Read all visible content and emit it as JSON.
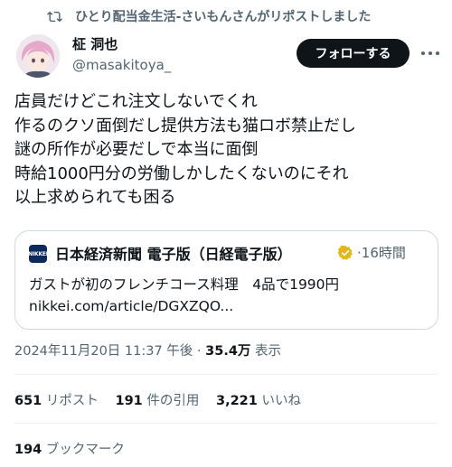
{
  "repost": {
    "text": "ひとり配当金生活-さいもんさんがリポストしました",
    "icon": "repost-icon"
  },
  "author": {
    "display_name": "柾 洞也",
    "handle": "@masakitoya_",
    "avatar": "avatar"
  },
  "follow_label": "フォローする",
  "tweet_lines": [
    "店員だけどこれ注文しないでくれ",
    "作るのクソ面倒だし提供方法も猫ロボ禁止だし",
    "謎の所作が必要だしで本当に面倒",
    "時給1000円分の労働しかしたくないのにそれ",
    "以上求められても困る"
  ],
  "card": {
    "logo_text": "NIKKEI",
    "source": "日本経済新聞 電子版（日経電子版）",
    "separator": "·",
    "time": "16時間",
    "title": "ガストが初のフレンチコース料理　4品で1990円",
    "url": "nikkei.com/article/DGXZQO..."
  },
  "meta": {
    "datetime": "2024年11月20日 11:37 午後",
    "separator": "·",
    "views": "35.4万",
    "views_label": "表示"
  },
  "stats": {
    "reposts": "651",
    "reposts_label": "リポスト",
    "quotes": "191",
    "quotes_label": "件の引用",
    "likes": "3,221",
    "likes_label": "いいね",
    "bookmarks": "194",
    "bookmarks_label": "ブックマーク"
  },
  "colors": {
    "text": "#0f1419",
    "muted": "#536471",
    "border": "#cfd9de",
    "verified": "#e2b719"
  }
}
